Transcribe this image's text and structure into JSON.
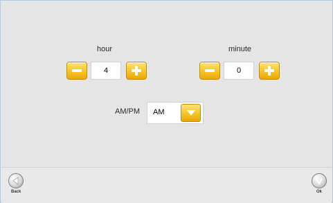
{
  "hour": {
    "label": "hour",
    "value": "4"
  },
  "minute": {
    "label": "minute",
    "value": "0"
  },
  "ampm": {
    "label": "AM/PM",
    "selected": "AM"
  },
  "footer": {
    "back_label": "Back",
    "ok_label": "Ok"
  },
  "icons": {
    "decrement": "minus-icon",
    "increment": "plus-icon",
    "dropdown": "chevron-down-icon",
    "back": "back-arrow-icon",
    "ok": "checkmark-icon"
  },
  "colors": {
    "button_gold": "#f7c62a",
    "background": "#e5e5e5"
  }
}
